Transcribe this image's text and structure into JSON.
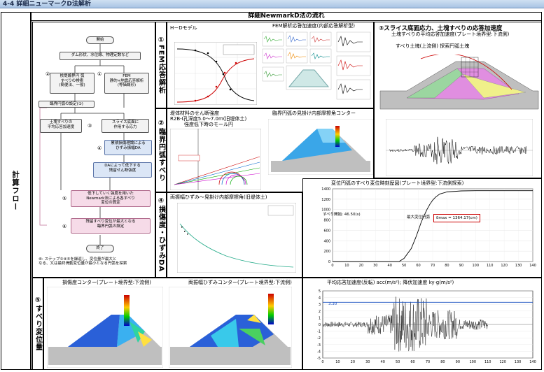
{
  "header": {
    "title": "4-4 詳細ニューマークD法解析"
  },
  "main_title": "詳細NewmarkD法の流れ",
  "left_label": "計算フロー",
  "flow": {
    "start": "開始",
    "s1": "ダム形状、水位線、物理定数など",
    "n2": "②",
    "s2": "核堤線界円 弧\nすべりの検索\n(簡便法、一般)",
    "n1": "①",
    "s3": "FEM\n静的+地震応答解析\n(等価線形)",
    "s4": "臨界円弧の設定(①)",
    "s5": "土塊すべりの\n平均応答加速度",
    "n3": "③",
    "s6": "スライス底面に\n作用する応力",
    "n4": "④",
    "s7": "累積損傷理論による\nひずみ振幅DA",
    "s8": "DAによって低下する\n残留せん断強度",
    "n5": "⑤",
    "s9": "低下していく強度を用いた\nNewmark法による各すべり\n変位の算定",
    "n6": "⑥",
    "s10": "残留すべり変位が最大となる\n臨界円弧の設定",
    "end": "終了",
    "note": "⑥: ステップ③④⑤を繰返し、変位量が最大と\nなる、又は最終滑動変位量が最小となる円弧を探索"
  },
  "sections": {
    "s1_label": "①FEM応答解析",
    "s1_hd_title": "H－Dモデル",
    "s1_fem_title": "FEM解析応答加速度(内部応答解析型)",
    "s2_label": "②臨界円弧すべり",
    "s2_title1": "堤体材料のせん断強度",
    "s2_title2": "R2B-Ⅰ孔深度5.0～7.0m(旧堤体土)",
    "s2_title3": "強度低下時のモール円",
    "s2_contour_title": "臨界円弧の見掛け内部摩擦角コンター",
    "s3_label": "③スライス底面応力、土塊すべりの応答加速度",
    "s3_sub": "土塊すべりの平均応答加速度(プレート境界型:下流側)",
    "s3_anno": "すべり土塊(上流側) 探索円弧土塊",
    "s4_label": "④損傷度・ひずみDA",
    "s4_title": "両振幅ひずみ～見掛け内部摩擦角(旧堤体土)",
    "s4_disp_title": "変位円弧のすべり変位時刻歴図(プレート境界型:下流側探索)",
    "s4_disp_anno1": "すべり開始: 46.50(s)",
    "s4_disp_anno2": "最大変位円弧",
    "s4_disp_anno3": "δmax = 1364.17(cm)",
    "s5_label": "⑤すべり変位量",
    "s5_title1": "損傷度コンター(プレート境界型:下流側)",
    "s5_title2": "両振幅ひずみコンター(プレート境界型:下流側)",
    "s5_title3": "平均応答加速度(反転) acc(m/s²); 降伏加速度 ky·g(m/s²)",
    "s5_ky": "3.30"
  },
  "chart_data": [
    {
      "type": "line",
      "title": "変位円弧のすべり変位時刻歴図(プレート境界型:下流側探索)",
      "xlabel": "",
      "ylabel": "",
      "xlim": [
        0,
        140
      ],
      "ylim": [
        0,
        1400
      ],
      "x_ticks": [
        0,
        10,
        20,
        30,
        40,
        50,
        60,
        70,
        80,
        90,
        100,
        110,
        120,
        130,
        140
      ],
      "y_ticks": [
        0,
        200,
        400,
        600,
        800,
        1000,
        1200,
        1400
      ],
      "series": [
        {
          "x": [
            0,
            46.5,
            50,
            55,
            58,
            60,
            62,
            64,
            66,
            68,
            70,
            72,
            75,
            80,
            90,
            100,
            110,
            120,
            130,
            140
          ],
          "y": [
            0,
            0,
            60,
            250,
            450,
            600,
            760,
            880,
            1000,
            1100,
            1180,
            1240,
            1300,
            1340,
            1360,
            1364,
            1364,
            1364,
            1364,
            1364
          ]
        }
      ]
    },
    {
      "type": "line",
      "title": "平均応答加速度(反転) acc(m/s²); 降伏加速度 ky·g(m/s²)",
      "xlim": [
        0,
        140
      ],
      "ylim": [
        -5,
        5
      ],
      "x_ticks": [
        0,
        10,
        20,
        30,
        40,
        50,
        60,
        70,
        80,
        90,
        100,
        110,
        120,
        130,
        140
      ],
      "y_ticks": [
        -5,
        -4,
        -3,
        -2,
        -1,
        0,
        1,
        2,
        3,
        4,
        5
      ],
      "ky": 3.3
    }
  ]
}
